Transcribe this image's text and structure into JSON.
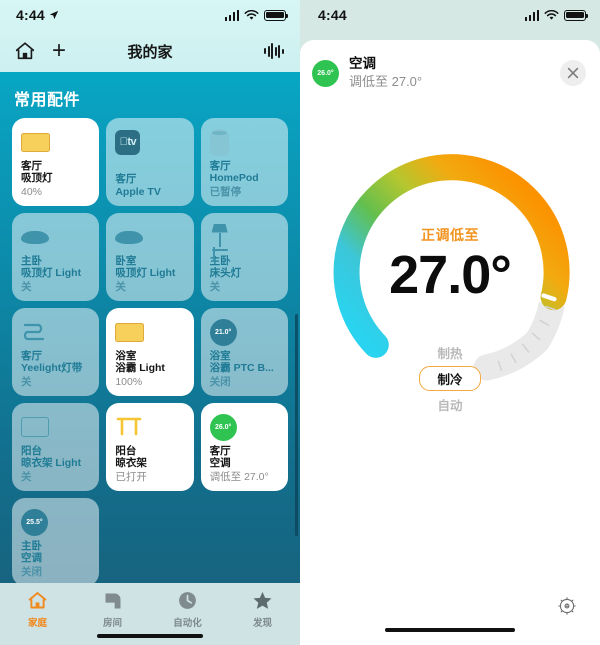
{
  "left": {
    "status_bar": {
      "time": "4:44",
      "location_icon": "location-arrow-icon",
      "signal_icon": "cellular-signal-icon",
      "wifi_icon": "wifi-icon",
      "battery_icon": "battery-icon"
    },
    "nav": {
      "home_icon": "home-icon",
      "add_label": "+",
      "title": "我的家",
      "waveform_icon": "audio-waveform-icon"
    },
    "section_title": "常用配件",
    "tiles": [
      {
        "icon": "ceiling-light-icon",
        "name_line1": "客厅",
        "name_line2": "吸顶灯",
        "state": "40%",
        "on": true
      },
      {
        "icon": "apple-tv-icon",
        "icon_text": "tv",
        "name_line1": "客厅",
        "name_line2": "Apple TV",
        "state": "",
        "on": false
      },
      {
        "icon": "homepod-icon",
        "name_line1": "客厅",
        "name_line2": "HomePod",
        "state": "已暂停",
        "on": false
      },
      {
        "icon": "ceiling-light-icon",
        "name_line1": "主卧",
        "name_line2": "吸顶灯 Light",
        "state": "关",
        "on": false
      },
      {
        "icon": "ceiling-light-icon",
        "name_line1": "卧室",
        "name_line2": "吸顶灯 Light",
        "state": "关",
        "on": false
      },
      {
        "icon": "floor-lamp-icon",
        "name_line1": "主卧",
        "name_line2": "床头灯",
        "state": "关",
        "on": false
      },
      {
        "icon": "light-strip-icon",
        "name_line1": "客厅",
        "name_line2": "Yeelight灯带",
        "state": "关",
        "on": false
      },
      {
        "icon": "ceiling-light-icon",
        "name_line1": "浴室",
        "name_line2": "浴霸 Light",
        "state": "100%",
        "on": true
      },
      {
        "icon": "thermostat-icon",
        "icon_text": "21.0°",
        "name_line1": "浴室",
        "name_line2": "浴霸 PTC B...",
        "state": "关闭",
        "on": false
      },
      {
        "icon": "panel-icon",
        "name_line1": "阳台",
        "name_line2": "晾衣架 Light",
        "state": "关",
        "on": false
      },
      {
        "icon": "clothes-rack-icon",
        "name_line1": "阳台",
        "name_line2": "晾衣架",
        "state": "已打开",
        "on": true
      },
      {
        "icon": "thermostat-icon",
        "icon_text": "26.0°",
        "name_line1": "客厅",
        "name_line2": "空调",
        "state": "调低至 27.0°",
        "on": true
      },
      {
        "icon": "thermostat-icon",
        "icon_text": "25.5°",
        "name_line1": "主卧",
        "name_line2": "空调",
        "state": "关闭",
        "on": false
      }
    ],
    "tabs": [
      {
        "icon": "home-icon",
        "label": "家庭",
        "active": true
      },
      {
        "icon": "rooms-icon",
        "label": "房间",
        "active": false
      },
      {
        "icon": "automation-clock-icon",
        "label": "自动化",
        "active": false
      },
      {
        "icon": "discover-star-icon",
        "label": "发现",
        "active": false
      }
    ]
  },
  "right": {
    "status_bar": {
      "time": "4:44",
      "signal_icon": "cellular-signal-icon",
      "wifi_icon": "wifi-icon",
      "battery_icon": "battery-icon"
    },
    "sheet": {
      "badge_temp": "26.0°",
      "title": "空调",
      "subtitle": "调低至 27.0°",
      "close_icon": "close-icon"
    },
    "dial": {
      "status_label": "正调低至",
      "temperature": "27.0°",
      "track_start_color": "#2ad3ef",
      "track_mid_color": "#63bf4e",
      "track_end_color": "#fb9300",
      "inactive_color": "#e9e9e9",
      "handle_color": "#ffffff"
    },
    "modes": [
      {
        "label": "制热",
        "selected": false
      },
      {
        "label": "制冷",
        "selected": true
      },
      {
        "label": "自动",
        "selected": false
      }
    ],
    "settings_icon": "gear-icon"
  }
}
